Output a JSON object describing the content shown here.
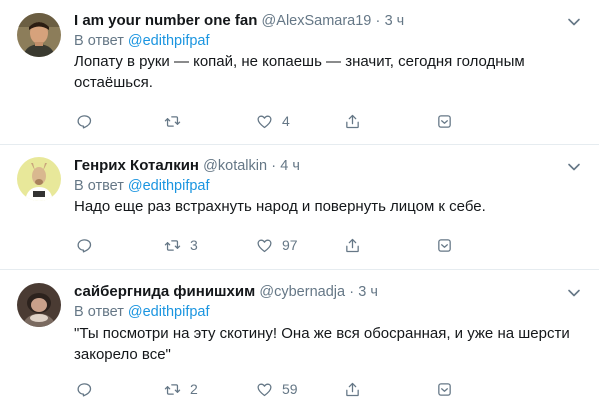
{
  "tweets": [
    {
      "name": "I am your number one fan",
      "handle": "@AlexSamara19",
      "separator": "·",
      "time": "3 ч",
      "reply_prefix": "В ответ",
      "reply_mention": "@edithpifpaf",
      "text": "Лопату в руки — копай, не копаешь — значит, сегодня голодным остаёшься.",
      "reply_count": "",
      "retweet_count": "",
      "like_count": "4"
    },
    {
      "name": "Генрих Коталкин",
      "handle": "@kotalkin",
      "separator": "·",
      "time": "4 ч",
      "reply_prefix": "В ответ",
      "reply_mention": "@edithpifpaf",
      "text": "Надо еще раз встрахнуть народ и повернуть лицом к себе.",
      "reply_count": "",
      "retweet_count": "3",
      "like_count": "97"
    },
    {
      "name": "сайбергнида финишхим",
      "handle": "@cybernadja",
      "separator": "·",
      "time": "3 ч",
      "reply_prefix": "В ответ",
      "reply_mention": "@edithpifpaf",
      "text": "\"Ты посмотри на эту скотину! Она же вся обосранная, и уже на шерсти закорело все\"",
      "reply_count": "",
      "retweet_count": "2",
      "like_count": "59"
    }
  ],
  "icons": {
    "reply": "reply-icon",
    "retweet": "retweet-icon",
    "like": "heart-icon",
    "share": "share-icon",
    "mute": "mute-conversation-icon",
    "more": "chevron-down-icon"
  },
  "colors": {
    "text": "#14171a",
    "secondary": "#657786",
    "link": "#1b95e0",
    "divider": "#e6ecf0"
  }
}
